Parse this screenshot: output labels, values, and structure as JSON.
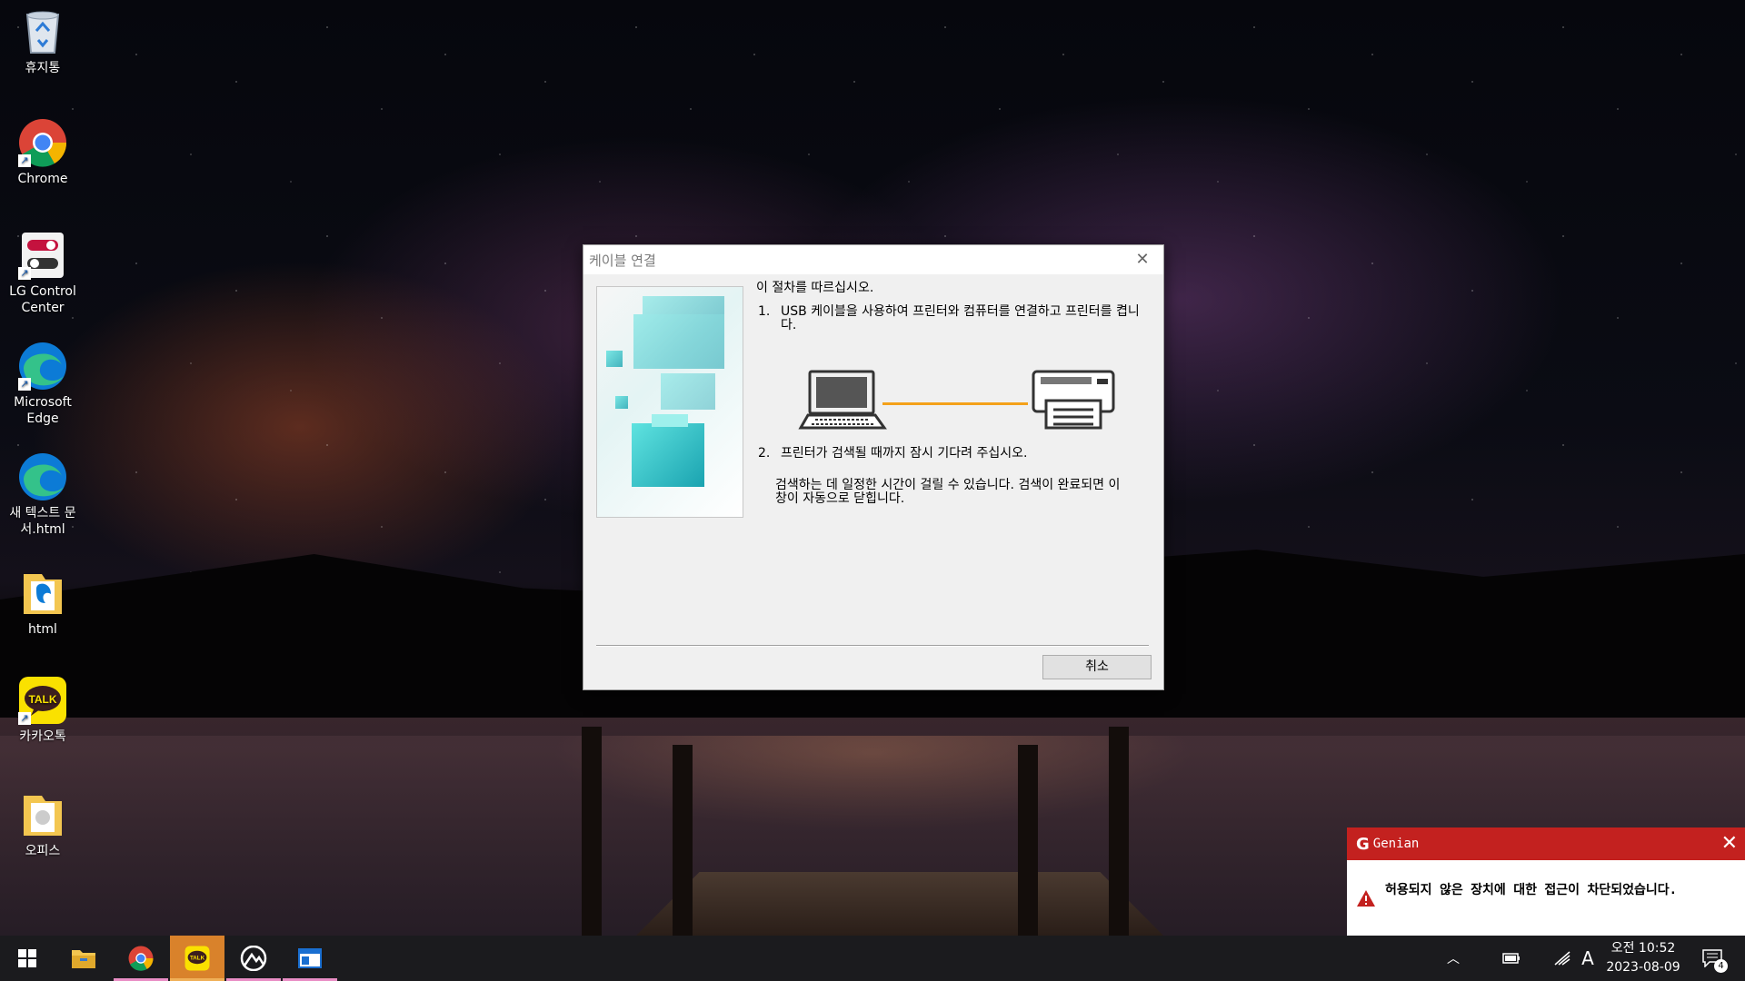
{
  "desktop_icons": [
    {
      "label": "휴지통",
      "icon": "recycle-bin-icon"
    },
    {
      "label": "Chrome",
      "icon": "chrome-icon"
    },
    {
      "label": "LG Control Center",
      "icon": "lg-control-center-icon"
    },
    {
      "label": "Microsoft Edge",
      "icon": "edge-icon"
    },
    {
      "label": "새 텍스트 문서.html",
      "icon": "edge-html-file-icon"
    },
    {
      "label": "html",
      "icon": "folder-icon"
    },
    {
      "label": "카카오톡",
      "icon": "kakaotalk-icon"
    },
    {
      "label": "오피스",
      "icon": "folder-icon"
    }
  ],
  "dialog": {
    "title": "케이블 연결",
    "intro": "이 절차를 따르십시오.",
    "step1_num": "1.",
    "step1_text": "USB 케이블을 사용하여 프린터와 컴퓨터를 연결하고 프린터를 켭니다.",
    "step2_num": "2.",
    "step2_text": "프린터가 검색될 때까지 잠시 기다려 주십시오.",
    "step2_note": "검색하는 데 일정한 시간이 걸릴 수 있습니다. 검색이 완료되면 이 창이 자동으로 닫힙니다.",
    "cancel_label": "취소"
  },
  "genian": {
    "logo": "G",
    "title": "Genian",
    "message": "허용되지 않은 장치에 대한 접근이 차단되었습니다."
  },
  "taskbar": {
    "apps": [
      "start-icon",
      "file-explorer-icon",
      "chrome-icon",
      "kakaotalk-icon",
      "photo-app-icon",
      "window-app-icon"
    ],
    "ime": "A",
    "time": "오전 10:52",
    "date": "2023-08-09",
    "notification_count": "4"
  },
  "colors": {
    "genian_red": "#c3211f",
    "cable_orange": "#f4a11a",
    "kakao_yellow": "#fae100"
  }
}
